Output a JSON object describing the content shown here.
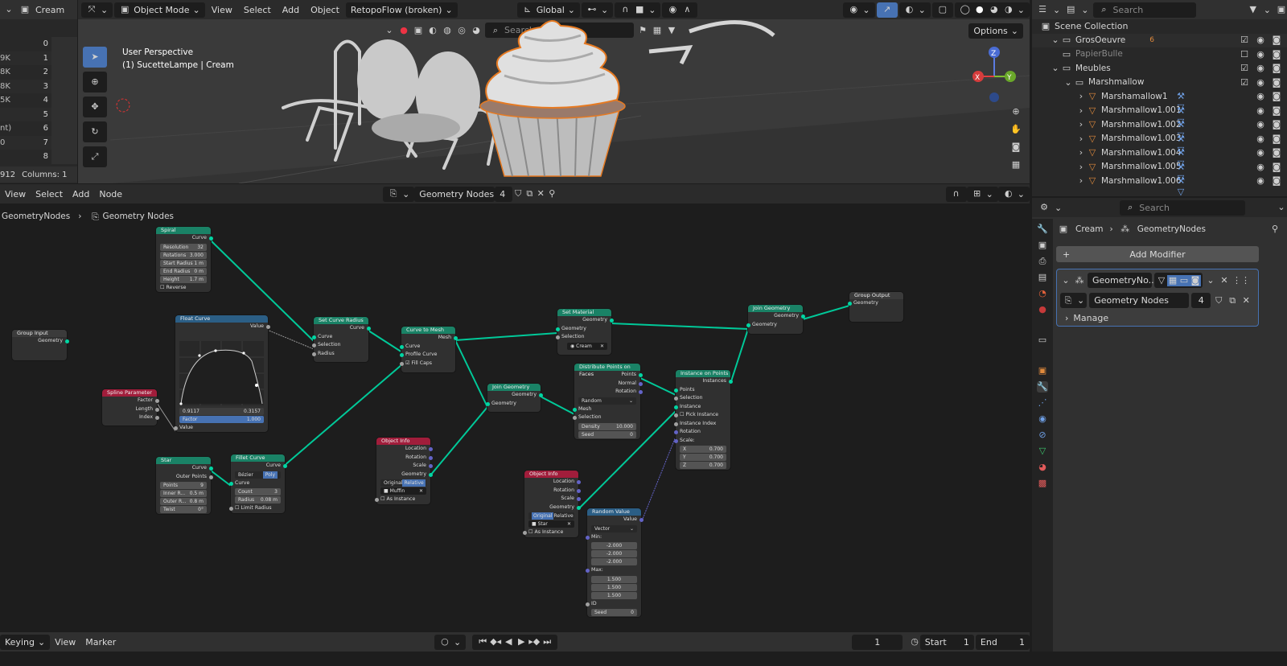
{
  "topbar": {
    "left_editor": "Cream",
    "mode": "Object Mode",
    "menus": [
      "View",
      "Select",
      "Add",
      "Object"
    ],
    "addon": "RetopoFlow (broken)",
    "orientation": "Global",
    "options": "Options",
    "search_placeholder": "Search"
  },
  "spreadsheet": {
    "rows": [
      "0",
      "1",
      "2",
      "3",
      "4",
      "5",
      "6",
      "7",
      "8"
    ],
    "frag": [
      "9K",
      "8K",
      "8K",
      "5K",
      "",
      "nt)",
      "0"
    ],
    "footer": "912",
    "columns": "Columns: 1"
  },
  "viewport": {
    "perspective": "User Perspective",
    "object_label": "(1) SucetteLampe | Cream"
  },
  "node_editor": {
    "menus": [
      "View",
      "Select",
      "Add",
      "Node"
    ],
    "tree_name": "Geometry Nodes",
    "users": "4",
    "breadcrumb_root": "GeometryNodes",
    "breadcrumb_tree": "Geometry Nodes"
  },
  "nodes": {
    "spiral": {
      "title": "Spiral",
      "out": "Curve",
      "resolution_label": "Resolution",
      "resolution": "32",
      "rotations_label": "Rotations",
      "rotations": "3.000",
      "start_radius_label": "Start Radius",
      "start_radius": "1 m",
      "end_radius_label": "End Radius",
      "end_radius": "0 m",
      "height_label": "Height",
      "height": "1.7 m",
      "reverse": "Reverse"
    },
    "group_input": {
      "title": "Group Input",
      "out": "Geometry"
    },
    "float_curve": {
      "title": "Float Curve",
      "out": "Value",
      "x": "0.9117",
      "y": "0.3157",
      "factor_label": "Factor",
      "factor": "1.000",
      "in": "Value"
    },
    "spline_param": {
      "title": "Spline Parameter",
      "factor": "Factor",
      "length": "Length",
      "index": "Index"
    },
    "set_curve_radius": {
      "title": "Set Curve Radius",
      "out": "Curve",
      "curve": "Curve",
      "selection": "Selection",
      "radius": "Radius"
    },
    "curve_to_mesh": {
      "title": "Curve to Mesh",
      "out": "Mesh",
      "curve": "Curve",
      "profile": "Profile Curve",
      "fill": "Fill Caps"
    },
    "set_material": {
      "title": "Set Material",
      "out": "Geometry",
      "geometry": "Geometry",
      "selection": "Selection",
      "material": "Cream"
    },
    "join1": {
      "title": "Join Geometry",
      "out": "Geometry",
      "in": "Geometry"
    },
    "join2": {
      "title": "Join Geometry",
      "out": "Geometry",
      "in": "Geometry"
    },
    "group_output": {
      "title": "Group Output",
      "in": "Geometry"
    },
    "distribute": {
      "title": "Distribute Points on Faces",
      "points": "Points",
      "normal": "Normal",
      "rotation": "Rotation",
      "mode": "Random",
      "mesh": "Mesh",
      "selection": "Selection",
      "density_label": "Density",
      "density": "10.000",
      "seed_label": "Seed",
      "seed": "0"
    },
    "instance_on_points": {
      "title": "Instance on Points",
      "out": "Instances",
      "points": "Points",
      "selection": "Selection",
      "instance": "Instance",
      "pick": "Pick Instance",
      "index": "Instance Index",
      "rotation": "Rotation",
      "scale": "Scale:",
      "x_label": "X",
      "x": "0.700",
      "y_label": "Y",
      "y": "0.700",
      "z_label": "Z",
      "z": "0.700"
    },
    "object_info1": {
      "title": "Object Info",
      "location": "Location",
      "rotation": "Rotation",
      "scale": "Scale",
      "geometry": "Geometry",
      "original": "Original",
      "relative": "Relative",
      "object": "Muffin",
      "as_instance": "As Instance"
    },
    "object_info2": {
      "title": "Object Info",
      "location": "Location",
      "rotation": "Rotation",
      "scale": "Scale",
      "geometry": "Geometry",
      "original": "Original",
      "relative": "Relative",
      "object": "Star",
      "as_instance": "As Instance"
    },
    "star": {
      "title": "Star",
      "curve": "Curve",
      "outer": "Outer Points",
      "points_label": "Points",
      "points": "9",
      "inner_label": "Inner R...",
      "inner": "0.5 m",
      "outerr_label": "Outer R...",
      "outerr": "0.8 m",
      "twist_label": "Twist",
      "twist": "0°"
    },
    "fillet": {
      "title": "Fillet Curve",
      "out": "Curve",
      "bezier": "Bézier",
      "poly": "Poly",
      "curve": "Curve",
      "count_label": "Count",
      "count": "3",
      "radius_label": "Radius",
      "radius": "0.08 m",
      "limit": "Limit Radius"
    },
    "random_value": {
      "title": "Random Value",
      "out": "Value",
      "type": "Vector",
      "min": "Min:",
      "min_x": "-2.000",
      "min_y": "-2.000",
      "min_z": "-2.000",
      "max": "Max:",
      "max_x": "1.500",
      "max_y": "1.500",
      "max_z": "1.500",
      "id": "ID",
      "seed_label": "Seed",
      "seed": "0"
    }
  },
  "timeline": {
    "keying": "Keying",
    "menus": [
      "View",
      "Marker"
    ],
    "frame": "1",
    "start_label": "Start",
    "start": "1",
    "end_label": "End",
    "end": "1"
  },
  "outliner": {
    "search_placeholder": "Search",
    "root": "Scene Collection",
    "items": [
      {
        "name": "GrosOeuvre",
        "indent": 1,
        "badge": "6"
      },
      {
        "name": "PapierBulle",
        "indent": 1,
        "badge": ""
      },
      {
        "name": "Meubles",
        "indent": 1,
        "badge": ""
      },
      {
        "name": "Marshmallow",
        "indent": 2,
        "badge": ""
      },
      {
        "name": "Marshamallow1",
        "indent": 3,
        "badge": ""
      },
      {
        "name": "Marshmallow1.001",
        "indent": 3,
        "badge": ""
      },
      {
        "name": "Marshmallow1.002",
        "indent": 3,
        "badge": ""
      },
      {
        "name": "Marshmallow1.003",
        "indent": 3,
        "badge": ""
      },
      {
        "name": "Marshmallow1.004",
        "indent": 3,
        "badge": ""
      },
      {
        "name": "Marshmallow1.005",
        "indent": 3,
        "badge": ""
      },
      {
        "name": "Marshmallow1.006",
        "indent": 3,
        "badge": ""
      }
    ]
  },
  "properties": {
    "search_placeholder": "Search",
    "breadcrumb_obj": "Cream",
    "breadcrumb_mod": "GeometryNodes",
    "add_modifier": "Add Modifier",
    "modifier_name": "GeometryNo...",
    "tree": "Geometry Nodes",
    "tree_users": "4",
    "manage": "Manage"
  },
  "colors": {
    "geometry_socket": "#00d6a3",
    "accent": "#4772b3",
    "header_green": "#1a8266",
    "header_red": "#a11d3b",
    "header_blue": "#2b5e85"
  }
}
